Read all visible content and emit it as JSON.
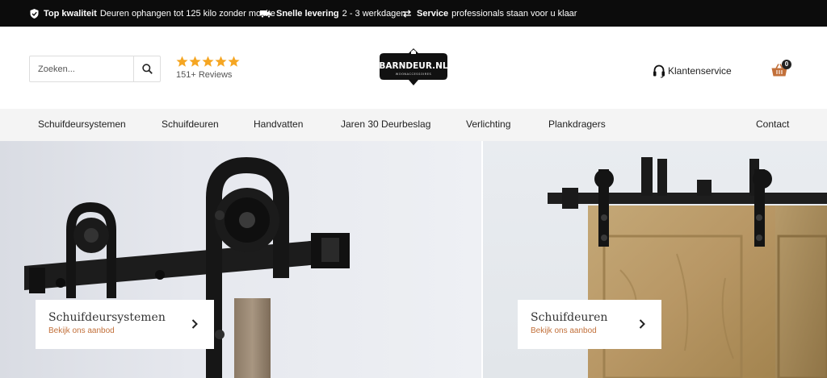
{
  "topbar": {
    "usps": [
      {
        "icon": "shield-check-icon",
        "bold": "Top kwaliteit",
        "text": "Deuren ophangen tot 125 kilo zonder moeite"
      },
      {
        "icon": "truck-icon",
        "bold": "Snelle levering",
        "text": "2 - 3 werkdagen"
      },
      {
        "icon": "exchange-icon",
        "bold": "Service",
        "text": "professionals staan voor u klaar"
      }
    ]
  },
  "header": {
    "search_placeholder": "Zoeken...",
    "rating": {
      "stars": 5,
      "reviews_label": "151+ Reviews",
      "star_color": "#f5a623"
    },
    "logo_text": "BARNDEUR.NL",
    "logo_subtext": "WOONACCESSOIRES",
    "service_label": "Klantenservice",
    "cart_count": "0",
    "accent_color": "#c2703a"
  },
  "nav": {
    "items": [
      "Schuifdeursystemen",
      "Schuifdeuren",
      "Handvatten",
      "Jaren 30 Deurbeslag",
      "Verlichting",
      "Plankdragers"
    ],
    "contact": "Contact"
  },
  "banners": [
    {
      "title": "Schuifdeursystemen",
      "subtitle": "Bekijk ons aanbod"
    },
    {
      "title": "Schuifdeuren",
      "subtitle": "Bekijk ons aanbod"
    }
  ]
}
